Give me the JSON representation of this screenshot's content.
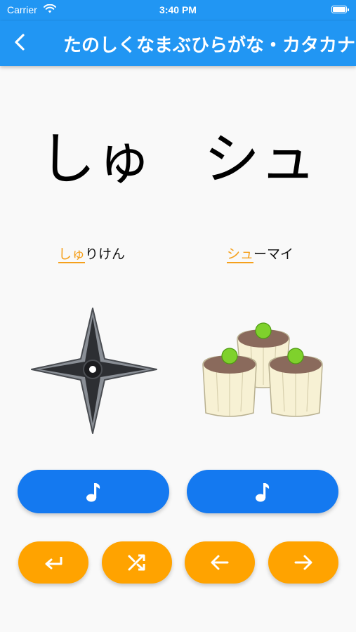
{
  "status_bar": {
    "carrier": "Carrier",
    "time": "3:40 PM"
  },
  "app_bar": {
    "title": "たのしくなまぶひらがな・カタカナ",
    "back_icon": "chevron-left-icon"
  },
  "characters": {
    "hiragana": "しゅ",
    "katakana": "シュ"
  },
  "words": {
    "left": {
      "highlight": "しゅ",
      "rest": "りけん"
    },
    "right": {
      "highlight": "シュ",
      "rest": "ーマイ"
    }
  },
  "illustrations": {
    "left": "shuriken",
    "right": "shumai"
  },
  "sound_buttons": {
    "left_icon": "music-note-icon",
    "right_icon": "music-note-icon"
  },
  "nav_buttons": [
    "return-icon",
    "shuffle-icon",
    "arrow-left-icon",
    "arrow-right-icon"
  ],
  "colors": {
    "app_bar": "#2196f3",
    "sound_button": "#1479f0",
    "nav_button": "#ffa300",
    "highlight": "#f5a01c"
  }
}
